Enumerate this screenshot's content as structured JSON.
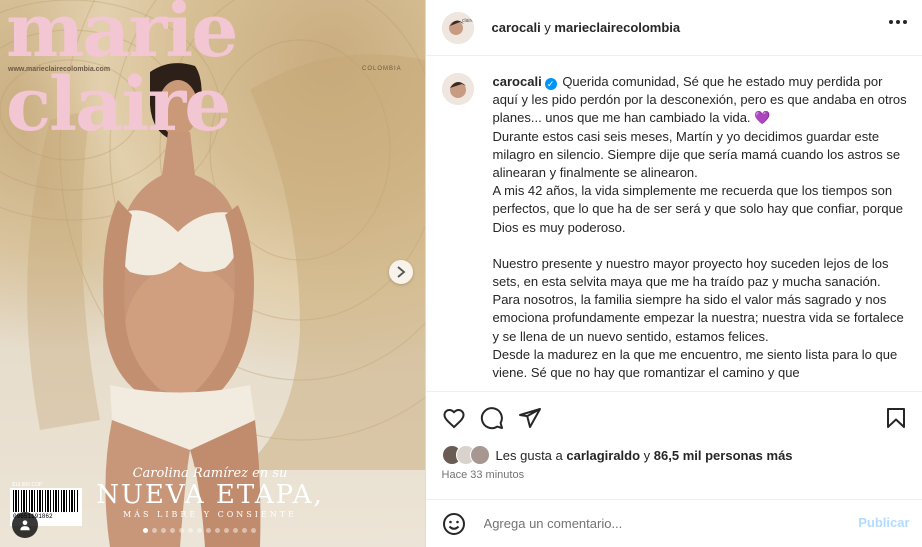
{
  "cover": {
    "magazine_title": "marie claire",
    "url": "www.marieclairecolombia.com",
    "country": "COLOMBIA",
    "tagline_1": "Carolina Ramírez en su",
    "tagline_2": "NUEVA ETAPA,",
    "tagline_3": "MÁS LIBRE Y CONSIENTE",
    "barcode_price": "$13.800 COP",
    "barcode_number": "09651191862",
    "carousel_dot_count": 13,
    "carousel_active_index": 0,
    "next_icon": "chevron-right-icon",
    "tag_icon": "user-tag-icon"
  },
  "header": {
    "user1": "carocali",
    "connector": " y ",
    "user2": "marieclairecolombia",
    "more_icon": "more-horizontal-icon"
  },
  "caption": {
    "username": "carocali",
    "paragraphs": [
      "Querida comunidad, Sé que he estado muy perdida por aquí y les pido perdón por la desconexión, pero es que andaba en otros planes... unos que me han cambiado la vida. 💜\nDurante estos casi seis meses, Martín y yo decidimos guardar este milagro en silencio. Siempre dije que sería mamá cuando los astros se alinearan y finalmente se alinearon.\nA mis 42 años, la vida simplemente me recuerda que los tiempos son perfectos, que lo que ha de ser será y que solo hay que confiar, porque Dios es muy poderoso.",
      "Nuestro presente y nuestro mayor proyecto hoy suceden lejos de los sets, en esta selvita maya que me ha traído paz y mucha sanación. Para nosotros, la familia siempre ha sido el valor más sagrado y nos emociona profundamente empezar la nuestra; nuestra vida se fortalece y se llena de un nuevo sentido, estamos felices.\nDesde la madurez en la que me encuentro, me siento lista para lo que viene. Sé que no hay que romantizar el camino y que"
    ]
  },
  "actions": {
    "like_icon": "heart-icon",
    "comment_icon": "comment-icon",
    "share_icon": "send-icon",
    "save_icon": "bookmark-icon"
  },
  "likes": {
    "prefix": "Les gusta a ",
    "user": "carlagiraldo",
    "middle": " y ",
    "count": "86,5 mil personas más"
  },
  "time": "Hace 33 minutos",
  "comment": {
    "emoji_icon": "emoji-icon",
    "placeholder": "Agrega un comentario...",
    "post_label": "Publicar"
  },
  "colors": {
    "accent": "#0095f6",
    "post_disabled": "#b3dbff",
    "magazine_pink": "#f3c6d3"
  }
}
